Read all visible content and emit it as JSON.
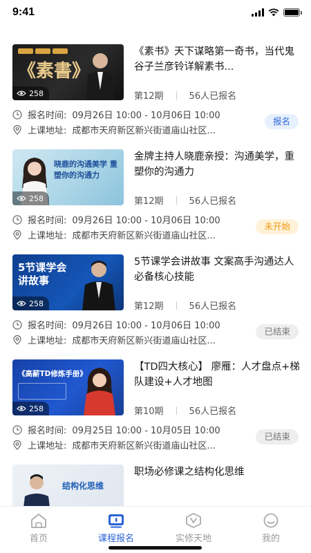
{
  "status": {
    "time": "9:41"
  },
  "courses": [
    {
      "title": "《素书》天下谋略第一奇书，当代鬼谷子兰彦铃详解素书...",
      "issue": "第12期",
      "enrolled": "56人已报名",
      "time_label": "报名时间:",
      "time_value": "09月26日 10:00 - 10月06日 10:00",
      "addr_label": "上课地址:",
      "addr_value": "成都市天府新区新兴街道庙山社区...",
      "views": "258",
      "status": "报名",
      "thumb_text": "《素書》"
    },
    {
      "title": "金牌主持人晓鹿亲授：沟通美学，重塑你的沟通力",
      "issue": "第12期",
      "enrolled": "56人已报名",
      "time_label": "报名时间:",
      "time_value": "09月26日 10:00 - 10月06日 10:00",
      "addr_label": "上课地址:",
      "addr_value": "成都市天府新区新兴街道庙山社区...",
      "views": "258",
      "status": "未开始",
      "thumb_text": "晓鹿的沟通美学 重塑你的沟通力"
    },
    {
      "title": "5节课学会讲故事 文案高手沟通达人必备核心技能",
      "issue": "第12期",
      "enrolled": "56人已报名",
      "time_label": "报名时间:",
      "time_value": "09月26日 10:00 - 10月06日 10:00",
      "addr_label": "上课地址:",
      "addr_value": "成都市天府新区新兴街道庙山社区...",
      "views": "258",
      "status": "已结束",
      "thumb_text": "5节课学会 讲故事"
    },
    {
      "title": "【TD四大核心】 廖雁：人才盘点+梯队建设+人才地图",
      "issue": "第10期",
      "enrolled": "56人已报名",
      "time_label": "报名时间:",
      "time_value": "09月25日 10:00 - 10月05日 10:00",
      "addr_label": "上课地址:",
      "addr_value": "成都市天府新区新兴街道庙山社区...",
      "views": "258",
      "status": "已结束",
      "thumb_text": "《高薪TD修炼手册》"
    },
    {
      "title": "职场必修课之结构化思维",
      "thumb_text": "结构化思维"
    }
  ],
  "tabs": [
    {
      "label": "首页",
      "icon": "home-icon"
    },
    {
      "label": "课程报名",
      "icon": "course-signup-icon"
    },
    {
      "label": "实修天地",
      "icon": "practice-icon"
    },
    {
      "label": "我的",
      "icon": "profile-icon"
    }
  ],
  "colors": {
    "accent": "#2a63d6",
    "badge_blue": "#2f68d8",
    "badge_orange": "#f39a12",
    "badge_gray": "#777777"
  }
}
